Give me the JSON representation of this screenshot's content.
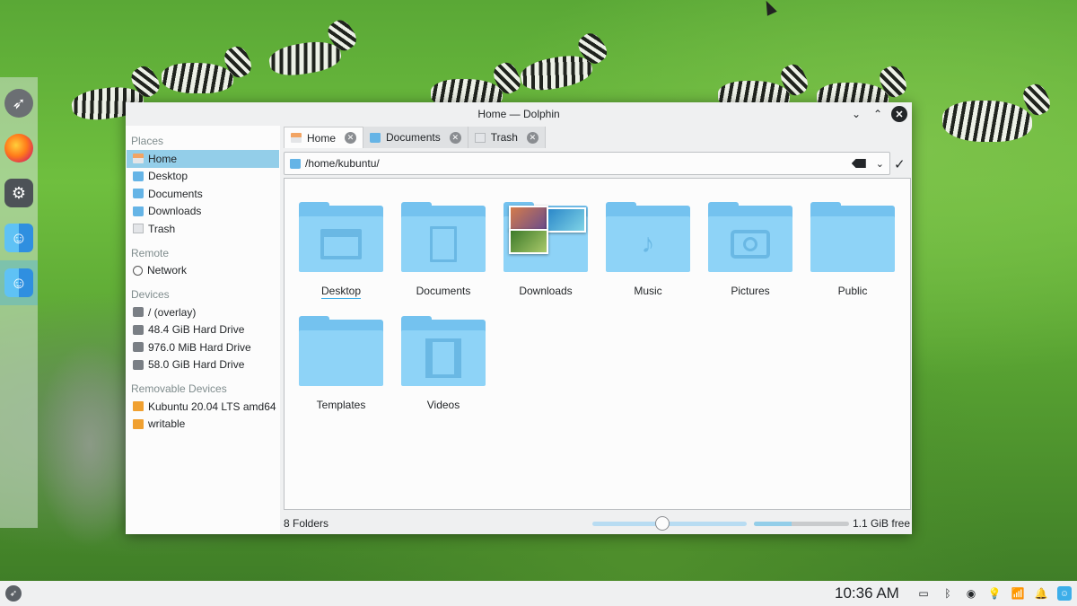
{
  "window": {
    "title": "Home — Dolphin"
  },
  "places": {
    "places_header": "Places",
    "places_items": [
      {
        "label": "Home",
        "icon": "home-icon"
      },
      {
        "label": "Desktop",
        "icon": "folder-icon"
      },
      {
        "label": "Documents",
        "icon": "folder-icon"
      },
      {
        "label": "Downloads",
        "icon": "folder-icon"
      },
      {
        "label": "Trash",
        "icon": "trash-icon"
      }
    ],
    "remote_header": "Remote",
    "remote_items": [
      {
        "label": "Network",
        "icon": "network-icon"
      }
    ],
    "devices_header": "Devices",
    "devices_items": [
      {
        "label": "/ (overlay)",
        "icon": "drive-icon"
      },
      {
        "label": "48.4 GiB Hard Drive",
        "icon": "drive-icon"
      },
      {
        "label": "976.0 MiB Hard Drive",
        "icon": "drive-icon"
      },
      {
        "label": "58.0 GiB Hard Drive",
        "icon": "drive-icon"
      }
    ],
    "removable_header": "Removable Devices",
    "removable_items": [
      {
        "label": "Kubuntu 20.04 LTS amd64",
        "icon": "usb-drive-icon"
      },
      {
        "label": "writable",
        "icon": "usb-drive-icon"
      }
    ]
  },
  "tabs": [
    {
      "label": "Home",
      "icon": "home-icon",
      "active": true
    },
    {
      "label": "Documents",
      "icon": "folder-icon",
      "active": false
    },
    {
      "label": "Trash",
      "icon": "trash-icon",
      "active": false
    }
  ],
  "location": {
    "path": "/home/kubuntu/"
  },
  "files": [
    {
      "label": "Desktop",
      "glyph": "desktop-icon"
    },
    {
      "label": "Documents",
      "glyph": "document-icon"
    },
    {
      "label": "Downloads",
      "glyph": "photos-preview"
    },
    {
      "label": "Music",
      "glyph": "music-note-icon"
    },
    {
      "label": "Pictures",
      "glyph": "camera-icon"
    },
    {
      "label": "Public",
      "glyph": "none"
    },
    {
      "label": "Templates",
      "glyph": "none"
    },
    {
      "label": "Videos",
      "glyph": "film-icon"
    }
  ],
  "status": {
    "summary": "8 Folders",
    "zoom_level": 0.45,
    "free_space": "1.1 GiB free",
    "used_fraction": 0.4
  },
  "taskbar": {
    "clock": "10:36 AM"
  },
  "colors": {
    "accent": "#3daee9",
    "selection": "#93cee9",
    "folder": "#74c2ef"
  }
}
